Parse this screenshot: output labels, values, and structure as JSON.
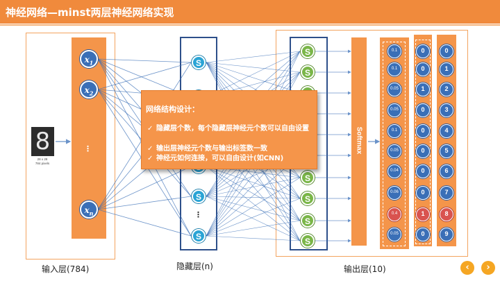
{
  "title": "神经网络—minst两层神经网络实现",
  "input_image": {
    "digit": "8",
    "caption_size": "28 x 28",
    "caption_pixels": "784 pixels"
  },
  "input_layer": {
    "nodes": [
      "x1",
      "x2",
      "xn"
    ],
    "node_main": "x",
    "subscripts": [
      "1",
      "2",
      "n"
    ],
    "ellipsis": "⋮",
    "label": "输入层(784)"
  },
  "hidden_layer": {
    "node_label": "S",
    "ellipsis": "⋮",
    "label": "隐藏层(n)"
  },
  "output_layer": {
    "node_label": "S",
    "softmax_label": "Softmax",
    "label": "输出层(10)"
  },
  "probabilities": [
    "0.1",
    "0.1",
    "0.05",
    "0.05",
    "0.1",
    "0.05",
    "0.04",
    "0.06",
    "0.4",
    "0.05"
  ],
  "highlight_index": 8,
  "onehot": [
    "0",
    "0",
    "1",
    "0",
    "0",
    "0",
    "0",
    "0",
    "1",
    "0"
  ],
  "digits": [
    "0",
    "1",
    "2",
    "3",
    "4",
    "5",
    "6",
    "7",
    "8",
    "9"
  ],
  "callout": {
    "title": "网络结构设计：",
    "items": [
      "隐藏层个数，每个隐藏层神经元个数可以自由设置",
      "输出层神经元个数与输出标签数一致",
      "神经元如何连接，可以自由设计(如CNN)"
    ],
    "check": "✓"
  },
  "nav": {
    "prev": "‹",
    "next": "›"
  },
  "colors": {
    "accent_orange": "#f08a3c",
    "node_blue": "#3a6fb7",
    "hidden_blue": "#2aa4d5",
    "output_green": "#7ab648",
    "highlight_red": "#d9534f",
    "edge_blue": "#3a6fb7",
    "nav_yellow": "#f5a623"
  }
}
